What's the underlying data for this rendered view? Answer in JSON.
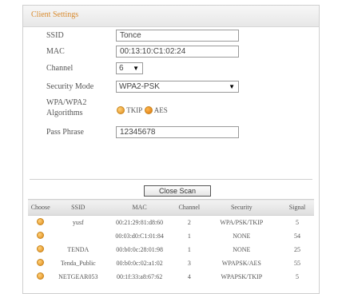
{
  "window": {
    "title": "Client Settings"
  },
  "form": {
    "ssid": {
      "label": "SSID",
      "value": "Tonce"
    },
    "mac": {
      "label": "MAC",
      "value": "00:13:10:C1:02:24"
    },
    "channel": {
      "label": "Channel",
      "value": "6"
    },
    "security_mode": {
      "label": "Security Mode",
      "value": "WPA2-PSK"
    },
    "algorithms": {
      "label_line1": "WPA/WPA2",
      "label_line2": "Algorithms",
      "option1": "TKIP",
      "option2": "AES",
      "selected": "AES"
    },
    "pass_phrase": {
      "label": "Pass Phrase",
      "value": "12345678"
    }
  },
  "scan": {
    "button_label": "Close Scan",
    "columns": [
      "Choose",
      "SSID",
      "MAC",
      "Channel",
      "Security",
      "Signal"
    ],
    "rows": [
      {
        "ssid": "yusf",
        "mac": "00:21:29:81:d8:60",
        "channel": "2",
        "security": "WPA/PSK/TKIP",
        "signal": "5"
      },
      {
        "ssid": "",
        "mac": "00:03:d0:C1:01:84",
        "channel": "1",
        "security": "NONE",
        "signal": "54"
      },
      {
        "ssid": "TENDA",
        "mac": "00:b0:0c:28:01:98",
        "channel": "1",
        "security": "NONE",
        "signal": "25"
      },
      {
        "ssid": "Tenda_Public",
        "mac": "00:b0:0c:02:a1:02",
        "channel": "3",
        "security": "WPAPSK/AES",
        "signal": "55"
      },
      {
        "ssid": "NETGEAR053",
        "mac": "00:1f:33:a8:67:62",
        "channel": "4",
        "security": "WPAPSK/TKIP",
        "signal": "5"
      }
    ]
  },
  "colors": {
    "accent": "#d88a2d",
    "radio": "#e08a1a"
  }
}
